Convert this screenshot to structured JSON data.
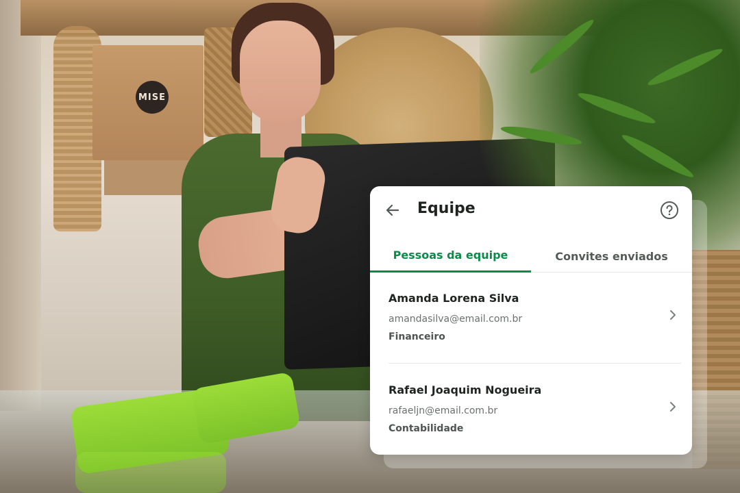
{
  "background": {
    "logo_text": "MISE",
    "description_icon": "store-photo"
  },
  "card": {
    "title": "Equipe",
    "back_icon": "arrow-left-icon",
    "help_icon": "question-circle-icon",
    "tabs": [
      {
        "label": "Pessoas da equipe",
        "active": true
      },
      {
        "label": "Convites enviados",
        "active": false
      }
    ],
    "members": [
      {
        "name": "Amanda Lorena Silva",
        "email": "amandasilva@email.com.br",
        "role": "Financeiro"
      },
      {
        "name": "Rafael Joaquim Nogueira",
        "email": "rafaeljn@email.com.br",
        "role": "Contabilidade"
      }
    ]
  },
  "colors": {
    "accent": "#0b8a4a",
    "text_primary": "#1f2421",
    "text_secondary": "#6a706c",
    "divider": "#e6e8e7"
  }
}
